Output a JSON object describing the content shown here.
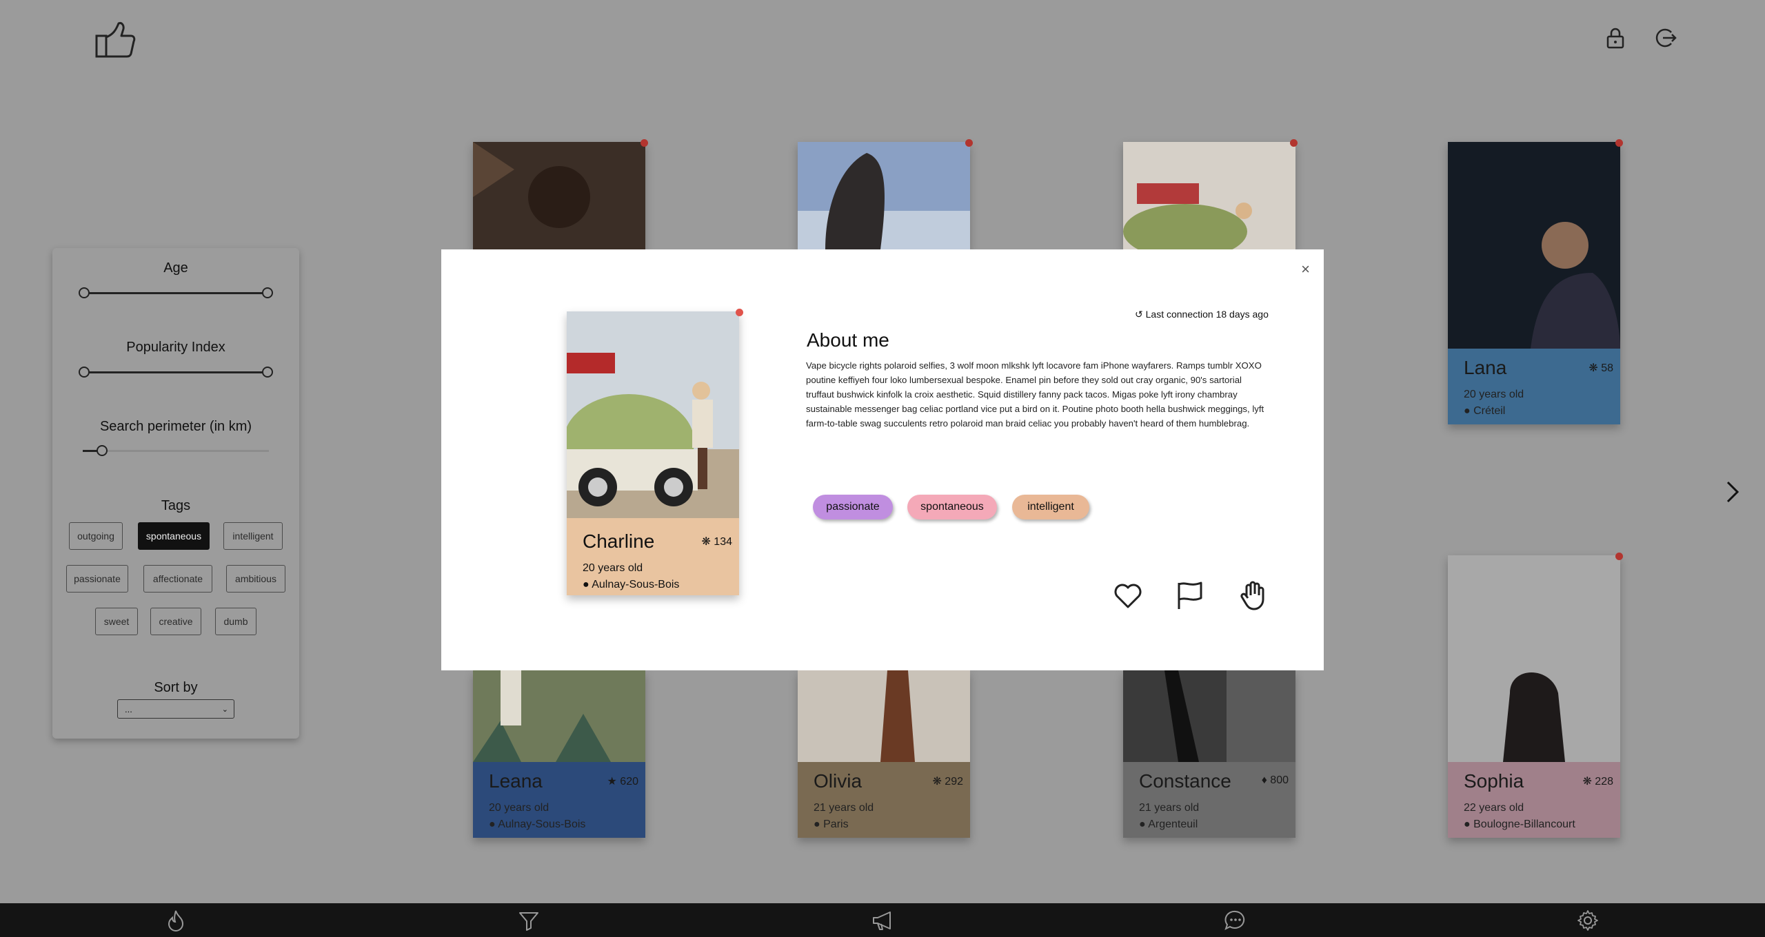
{
  "header": {
    "logo_icon": "thumbs-up-hand-icon",
    "lock_icon": "lock-icon",
    "logout_icon": "logout-icon"
  },
  "filters": {
    "age_label": "Age",
    "popularity_label": "Popularity Index",
    "perimeter_label": "Search perimeter (in km)",
    "tags_label": "Tags",
    "tags": [
      {
        "label": "outgoing",
        "active": false
      },
      {
        "label": "spontaneous",
        "active": true
      },
      {
        "label": "intelligent",
        "active": false
      },
      {
        "label": "passionate",
        "active": false
      },
      {
        "label": "affectionate",
        "active": false
      },
      {
        "label": "ambitious",
        "active": false
      },
      {
        "label": "sweet",
        "active": false
      },
      {
        "label": "creative",
        "active": false
      },
      {
        "label": "dumb",
        "active": false
      }
    ],
    "sort_label": "Sort by",
    "sort_value": "..."
  },
  "profiles": [
    {
      "name": "Lana",
      "score": "58",
      "age": "20 years old",
      "location": "Créteil",
      "color": "#3d6a90"
    },
    {
      "name": "Leana",
      "score": "620",
      "age": "20 years old",
      "location": "Aulnay-Sous-Bois",
      "color": "#2c4a7a"
    },
    {
      "name": "Olivia",
      "score": "292",
      "age": "21 years old",
      "location": "Paris",
      "color": "#7a6a52"
    },
    {
      "name": "Constance",
      "score": "800",
      "age": "21 years old",
      "location": "Argenteuil",
      "color": "#6b6b6b"
    },
    {
      "name": "Sophia",
      "score": "228",
      "age": "22 years old",
      "location": "Boulogne-Billancourt",
      "color": "#a0808a"
    }
  ],
  "modal": {
    "name": "Charline",
    "score": "134",
    "age": "20 years old",
    "location": "Aulnay-Sous-Bois",
    "last_connection": "Last connection 18 days ago",
    "about_title": "About me",
    "about_text": "Vape bicycle rights polaroid selfies, 3 wolf moon mlkshk lyft locavore fam iPhone wayfarers. Ramps tumblr XOXO poutine keffiyeh four loko lumbersexual bespoke. Enamel pin before they sold out cray organic, 90's sartorial truffaut bushwick kinfolk la croix aesthetic. Squid distillery fanny pack tacos. Migas poke lyft irony chambray sustainable messenger bag celiac portland vice put a bird on it. Poutine photo booth hella bushwick meggings, lyft farm-to-table swag succulents retro polaroid man braid celiac you probably haven't heard of them humblebrag.",
    "tags": [
      {
        "label": "passionate",
        "color": "#c08ee0"
      },
      {
        "label": "spontaneous",
        "color": "#f4a9b8"
      },
      {
        "label": "intelligent",
        "color": "#e9b896"
      }
    ],
    "actions": [
      "heart-icon",
      "flag-icon",
      "hand-stop-icon"
    ]
  },
  "bottom_nav": [
    "flame-icon",
    "filter-icon",
    "megaphone-icon",
    "chat-icon",
    "settings-gear-icon"
  ]
}
